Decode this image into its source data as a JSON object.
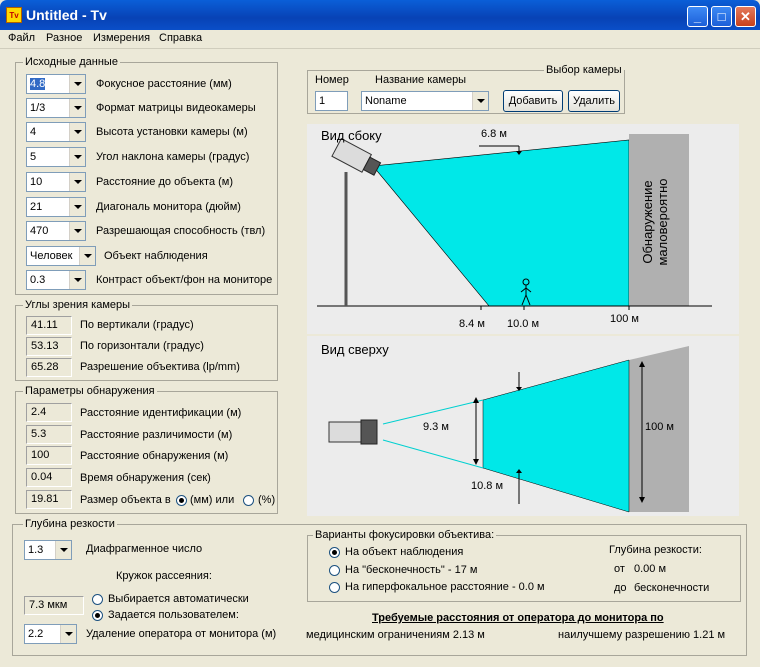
{
  "window": {
    "title": "Untitled - Tv",
    "icon": "tv-app-icon"
  },
  "menu": [
    "Файл",
    "Разное",
    "Измерения",
    "Справка"
  ],
  "input": {
    "title": "Исходные данные",
    "rows": [
      {
        "value": "4.8",
        "label": "Фокусное расстояние (мм)"
      },
      {
        "value": "1/3",
        "label": "Формат матрицы видеокамеры"
      },
      {
        "value": "4",
        "label": "Высота установки камеры (м)"
      },
      {
        "value": "5",
        "label": "Угол наклона камеры (градус)"
      },
      {
        "value": "10",
        "label": "Расстояние до объекта (м)"
      },
      {
        "value": "21",
        "label": "Диагональ монитора (дюйм)"
      },
      {
        "value": "470",
        "label": "Разрешающая способность (твл)"
      },
      {
        "value": "Человек",
        "label": "Объект наблюдения"
      },
      {
        "value": "0.3",
        "label": "Контраст объект/фон на мониторе"
      }
    ]
  },
  "angles": {
    "title": "Углы зрения камеры",
    "rows": [
      {
        "value": "41.11",
        "label": "По вертикали (градус)"
      },
      {
        "value": "53.13",
        "label": "По горизонтали (градус)"
      },
      {
        "value": "65.28",
        "label": "Разрешение объектива (lp/mm)"
      }
    ]
  },
  "detection": {
    "title": "Параметры обнаружения",
    "rows": [
      {
        "value": "2.4",
        "label": "Расстояние идентификации (м)"
      },
      {
        "value": "5.3",
        "label": "Расстояние различимости (м)"
      },
      {
        "value": "100",
        "label": "Расстояние обнаружения (м)"
      },
      {
        "value": "0.04",
        "label": "Время обнаружения (сек)"
      },
      {
        "value": "19.81",
        "label": "Размер объекта в"
      }
    ],
    "unit_mm": "(мм) или",
    "unit_pct": "(%)"
  },
  "camera": {
    "title": "Выбор камеры",
    "number_label": "Номер",
    "name_label": "Название камеры",
    "number": "1",
    "name": "Noname",
    "add": "Добавить",
    "delete": "Удалить"
  },
  "side_view": {
    "title": "Вид сбоку",
    "top_label": "6.8 м",
    "zone_label": "Обнаружение маловероятно",
    "ticks": [
      "8.4 м",
      "10.0 м",
      "100 м"
    ]
  },
  "top_view": {
    "title": "Вид сверху",
    "width_near": "9.3 м",
    "width_far": "100 м",
    "near_dist": "10.8 м"
  },
  "dof": {
    "title": "Глубина резкости",
    "aperture_value": "1.3",
    "aperture_label": "Диафрагменное число",
    "coc_label": "Кружок рассеяния:",
    "coc_value": "7.3 мкм",
    "auto_label": "Выбирается автоматически",
    "user_label": "Задается пользователем:",
    "distance_value": "2.2",
    "distance_label": "Удаление оператора от монитора (м)"
  },
  "focus": {
    "title": "Варианты фокусировки объектива:",
    "opt1": "На объект наблюдения",
    "opt2": "На \"бесконечность\" -  17 м",
    "opt3": "На гиперфокальное расстояние -  0.0 м",
    "depth_title": "Глубина резкости:",
    "from_label": "от",
    "from_value": "0.00 м",
    "to_label": "до",
    "to_value": "бесконечности"
  },
  "required": {
    "title": "Требуемые расстояния от оператора до монитора по",
    "medical": "медицинским ограничениям  2.13 м",
    "best": "наилучшему разрешению  1.21 м"
  },
  "colors": {
    "zone": "#00e8e8",
    "nodetect": "#b0b0b0",
    "titlebar": "#0a4ec8"
  }
}
